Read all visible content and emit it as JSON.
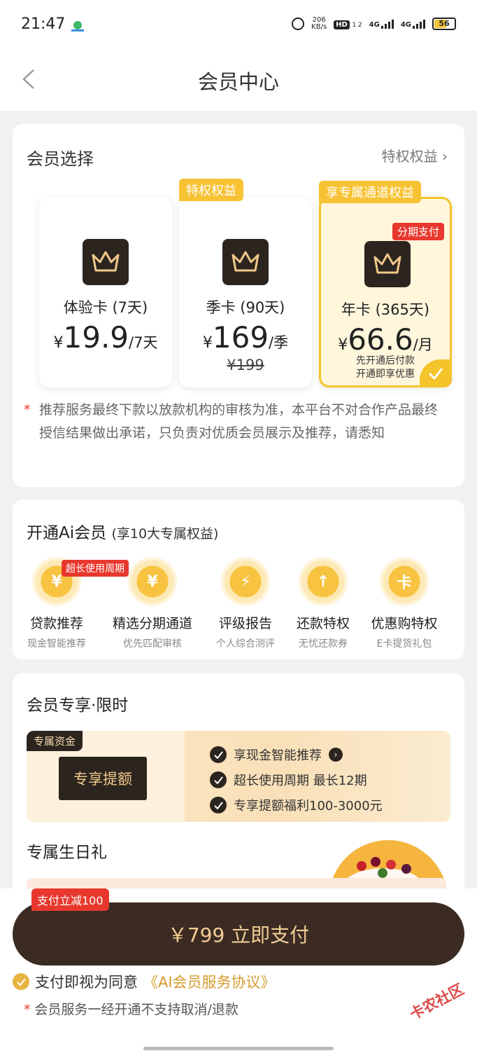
{
  "status_bar": {
    "time": "21:47",
    "net_speed": "206",
    "net_unit": "KB/s",
    "hd": "HD",
    "hd_sub": "1 2",
    "sig1": "4G",
    "sig2": "4G",
    "battery": "56"
  },
  "header": {
    "title": "会员中心"
  },
  "membership": {
    "title": "会员选择",
    "link": "特权权益",
    "plans": [
      {
        "name": "体验卡 (7天)",
        "yen": "¥",
        "price": "19.9",
        "unit": "/7天"
      },
      {
        "tag": "特权权益",
        "name": "季卡 (90天)",
        "yen": "¥",
        "price": "169",
        "unit": "/季",
        "old_price": "¥199"
      },
      {
        "tag": "享专属通道权益",
        "badge": "分期支付",
        "name": "年卡 (365天)",
        "yen": "¥",
        "price": "66.6",
        "unit": "/月",
        "note1": "先开通后付款",
        "note2": "开通即享优惠"
      }
    ],
    "notice": "推荐服务最终下款以放款机构的审核为准，本平台不对合作产品最终授信结果做出承诺，只负责对优质会员展示及推荐，请悉知"
  },
  "ai_member": {
    "title": "开通Ai会员",
    "subtitle": "(享10大专属权益)",
    "badge": "超长使用周期",
    "items": [
      {
        "name": "贷款推荐",
        "sub": "现金智能推荐",
        "glyph": "¥"
      },
      {
        "name": "精选分期通道",
        "sub": "优先匹配审核",
        "glyph": "¥"
      },
      {
        "name": "评级报告",
        "sub": "个人综合测评",
        "glyph": "⚡"
      },
      {
        "name": "还款特权",
        "sub": "无忧还款券",
        "glyph": "↑"
      },
      {
        "name": "优惠购特权",
        "sub": "E卡提货礼包",
        "glyph": "卡"
      }
    ]
  },
  "exclusive": {
    "title": "会员专享·限时",
    "banner_tag": "专属资金",
    "banner_label": "专享提额",
    "rows": [
      "享现金智能推荐",
      "超长使用周期 最长12期",
      "专享提额福利100-3000元"
    ],
    "birthday": "专属生日礼"
  },
  "footer": {
    "pay_tag": "支付立减100",
    "pay_button": "￥799 立即支付",
    "agree_text": "支付即视为同意",
    "agree_link": "《AI会员服务协议》",
    "refund_note": "会员服务一经开通不支持取消/退款"
  },
  "watermark": "卡农社区"
}
